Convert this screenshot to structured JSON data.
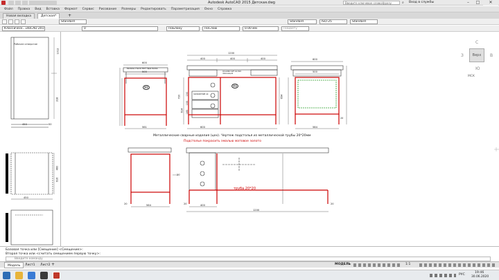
{
  "window": {
    "title": "Autodesk AutoCAD 2015   Детская.dwg",
    "search_placeholder": "Введите ключевое слово/фразу",
    "login_label": "Вход в службы"
  },
  "menu": [
    "Файл",
    "Правка",
    "Вид",
    "Вставка",
    "Формат",
    "Сервис",
    "Рисование",
    "Размеры",
    "Редактировать",
    "Параметризация",
    "Окно",
    "Справка"
  ],
  "tabs": [
    {
      "label": "Новая вкладка",
      "active": false
    },
    {
      "label": "Детская*",
      "active": true
    }
  ],
  "toolbar": {
    "workspace": "Классическ...utoCAD 2015",
    "text_style": "Standard",
    "dim_style": "ISO-25",
    "table_style": "Standard",
    "mleader_style": "Standard",
    "layer": "0",
    "color": "ПоБлоку",
    "linetype": "ПоСлою",
    "lineweight": "0.00 мм",
    "plot_style": "ПоЦвету"
  },
  "viewcube": {
    "north": "С",
    "south": "Ю",
    "west": "З",
    "east": "В",
    "face": "Верх",
    "wcs": "МСК"
  },
  "drawing": {
    "top_views": {
      "side_width": "600",
      "side_depth_inner": "500",
      "side_bottom": "561",
      "leg_height": "20",
      "front_total": "1200",
      "front_seg1": "400",
      "front_seg2": "400",
      "front_seg3": "400",
      "front_inner": "614",
      "front_bottom": "600",
      "right_top": "600",
      "right_inner": "500",
      "right_bottom": "584",
      "drawer_h1": "150",
      "drawer_h2": "155",
      "drawer_h3": "185",
      "heights_a": "720",
      "heights_b": "654",
      "label_m6": "М6",
      "glass_note": "Базовое стекло MDF Ндак Белое",
      "shelf_note": "QUADRO SPF 16,500 ламинация",
      "fixtures_note": "ЗАНИЖЕНИЕ 40"
    },
    "caption_1": "Металлические сварные изделия (цех). Чертеж подстолья из металлической трубы 20*20мм",
    "caption_2": "Подстолье покрасить эмалью матовое золото",
    "bottom_views": {
      "left_width": "564",
      "left_leg": "20",
      "front_total": "1200",
      "front_part": "400",
      "pipe": "труба 20*20",
      "pipe_side": "20"
    },
    "left_partial": {
      "w1": "450",
      "w2": "50",
      "h1": "1012",
      "h2": "318",
      "h3": "460",
      "h4": "616",
      "note": "Рабочее отверстие"
    }
  },
  "command": {
    "line1": "Базовая точка или [Смещение] <Смещение>:",
    "line2": "Вторая точка или <считать смещением первую точку>:",
    "prompt": "Введите команду"
  },
  "layout_tabs": [
    "Модель",
    "Лист1",
    "Лист2"
  ],
  "status": {
    "model": "МОДЕЛЬ",
    "scale": "1:1"
  },
  "taskbar": {
    "lang": "РУС",
    "time": "19:46",
    "date": "30.06.2020"
  }
}
